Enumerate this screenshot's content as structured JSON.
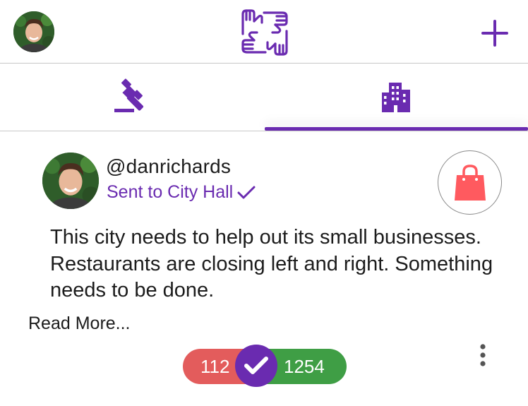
{
  "header": {
    "profile_icon": "user-avatar",
    "logo_icon": "four-hands-logo-icon",
    "add_icon": "plus-icon"
  },
  "tabs": [
    {
      "name": "laws",
      "icon": "gavel-icon",
      "active": false
    },
    {
      "name": "city",
      "icon": "building-icon",
      "active": true
    }
  ],
  "post": {
    "username": "@danrichards",
    "status": "Sent to City Hall",
    "status_icon": "checkmark-icon",
    "category_icon": "shopping-bag-icon",
    "text": "This city needs to help out its small businesses. Restaurants are closing left and right. Something needs to be done.",
    "read_more": "Read More...",
    "votes_against": "112",
    "votes_for": "1254",
    "vote_icon": "check-circle-icon",
    "more_icon": "vertical-ellipsis-icon"
  },
  "colors": {
    "accent": "#6a2bb0",
    "against": "#e35c5c",
    "for": "#3f9e45",
    "bag": "#ff5a5f"
  }
}
